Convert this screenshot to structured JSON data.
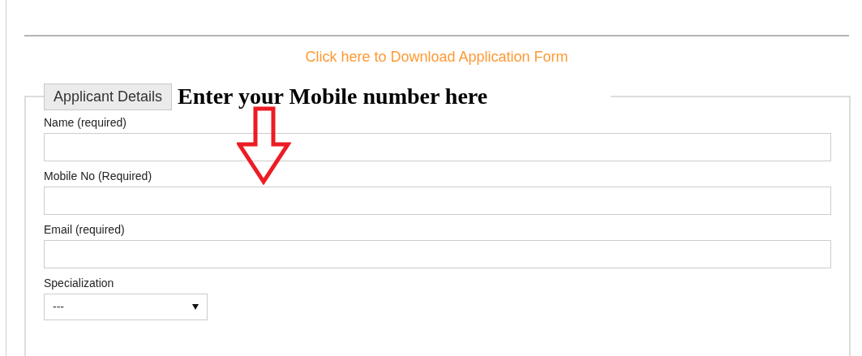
{
  "download_link": "Click here to Download Application Form",
  "section": {
    "legend": "Applicant Details",
    "annotation": "Enter your Mobile number here"
  },
  "fields": [
    {
      "kind": "text",
      "label": "Name (required)"
    },
    {
      "kind": "text",
      "label": "Mobile No (Required)"
    },
    {
      "kind": "text",
      "label": "Email (required)"
    },
    {
      "kind": "select",
      "label": "Specialization",
      "value": "---"
    }
  ]
}
